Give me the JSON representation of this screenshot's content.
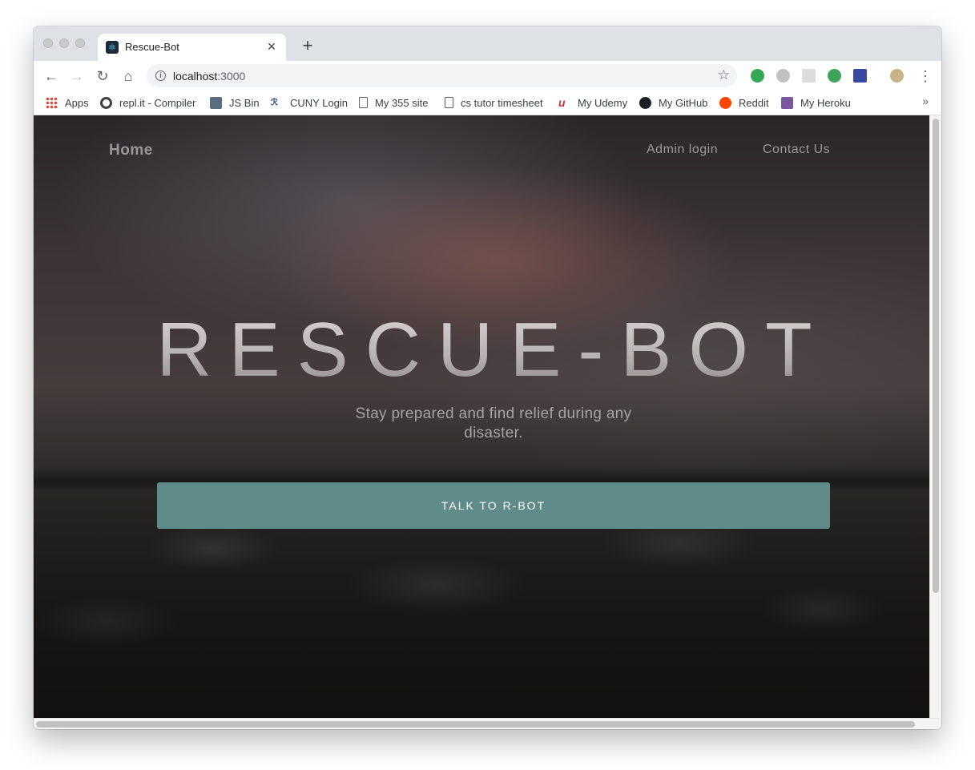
{
  "browser": {
    "tab": {
      "title": "Rescue-Bot",
      "close_label": "×"
    },
    "new_tab_label": "+",
    "nav": {
      "back": "←",
      "forward": "→",
      "reload": "↻",
      "home": "⌂"
    },
    "url": {
      "host": "localhost",
      "port": ":3000"
    },
    "star": "☆",
    "menu": "⋮",
    "bookmarks": [
      {
        "label": "Apps",
        "icon": "apps-grid-icon"
      },
      {
        "label": "repl.it - Compiler",
        "icon": "replit-icon"
      },
      {
        "label": "JS Bin",
        "icon": "jsbin-icon"
      },
      {
        "label": "CUNY Login",
        "icon": "cuny-icon"
      },
      {
        "label": "My 355 site",
        "icon": "page-icon"
      },
      {
        "label": "cs tutor timesheet",
        "icon": "page-icon"
      },
      {
        "label": "My Udemy",
        "icon": "udemy-icon"
      },
      {
        "label": "My GitHub",
        "icon": "github-icon"
      },
      {
        "label": "Reddit",
        "icon": "reddit-icon"
      },
      {
        "label": "My Heroku",
        "icon": "heroku-icon"
      }
    ],
    "bookmarks_more": "»",
    "extension_colors": [
      "#34a853",
      "#b9b9b9",
      "#d9d9d9",
      "#3da55a",
      "#3b4aa0",
      "#c9b48a"
    ]
  },
  "site": {
    "nav": {
      "home": "Home",
      "admin_login": "Admin login",
      "contact_us": "Contact Us"
    },
    "hero": {
      "title": "RESCUE-BOT",
      "subtitle": "Stay prepared and find relief during any disaster.",
      "cta_label": "TALK TO R-BOT"
    },
    "colors": {
      "cta": "#5f8b88",
      "nav_text": "#9b9797"
    }
  }
}
